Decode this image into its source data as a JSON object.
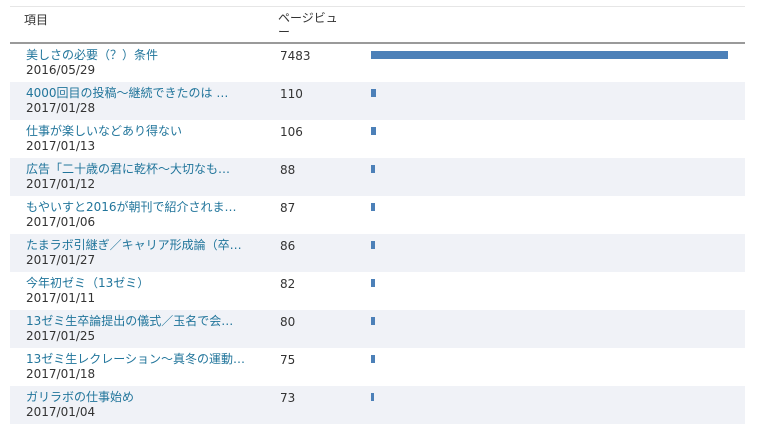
{
  "header": {
    "item_label": "項目",
    "views_label": "ページビュー"
  },
  "max_views": 7483,
  "colors": {
    "link": "#21759b",
    "bar": "#4c80b8",
    "row_alt": "#f0f2f7"
  },
  "rows": [
    {
      "title": "美しさの必要（？）条件",
      "date": "2016/05/29",
      "views": 7483
    },
    {
      "title": "4000回目の投稿〜継続できたのは …",
      "date": "2017/01/28",
      "views": 110
    },
    {
      "title": "仕事が楽しいなどあり得ない",
      "date": "2017/01/13",
      "views": 106
    },
    {
      "title": "広告「二十歳の君に乾杯〜大切なも…",
      "date": "2017/01/12",
      "views": 88
    },
    {
      "title": "もやいすと2016が朝刊で紹介されま…",
      "date": "2017/01/06",
      "views": 87
    },
    {
      "title": "たまラボ引継ぎ／キャリア形成論（卒…",
      "date": "2017/01/27",
      "views": 86
    },
    {
      "title": "今年初ゼミ（13ゼミ）",
      "date": "2017/01/11",
      "views": 82
    },
    {
      "title": "13ゼミ生卒論提出の儀式／玉名で会…",
      "date": "2017/01/25",
      "views": 80
    },
    {
      "title": "13ゼミ生レクレーション〜真冬の運動…",
      "date": "2017/01/18",
      "views": 75
    },
    {
      "title": "ガリラボの仕事始め",
      "date": "2017/01/04",
      "views": 73
    }
  ]
}
